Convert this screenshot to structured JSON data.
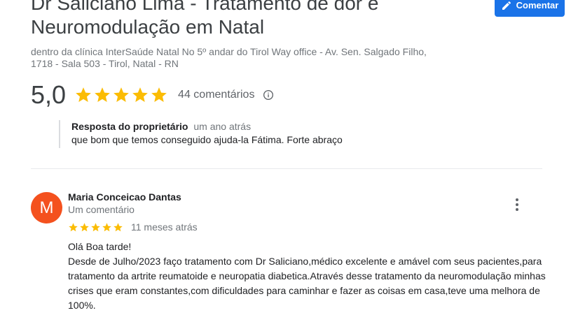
{
  "header": {
    "title": "Dr Saliciano Lima - Tratamento de dor e Neuromodulação em Natal",
    "comment_button": "Comentar",
    "comment_icon": "pencil-icon",
    "address": "dentro da clínica InterSaúde Natal No 5º andar do Tirol Way office - Av. Sen. Salgado Filho, 1718 - Sala 503 - Tirol, Natal - RN"
  },
  "rating": {
    "value": "5,0",
    "stars": 5,
    "count_label": "44 comentários",
    "info_icon": "info-icon",
    "star_color": "#fbbc04"
  },
  "owner_reply": {
    "label": "Resposta do proprietário",
    "time": "um ano atrás",
    "text": "que bom que temos conseguido ajuda-la Fátima. Forte abraço"
  },
  "review": {
    "avatar_letter": "M",
    "avatar_color": "#f4511e",
    "name": "Maria Conceicao Dantas",
    "meta": "Um comentário",
    "stars": 5,
    "time": "11 meses atrás",
    "more_icon": "more-vert-icon",
    "lines": [
      "Olá Boa tarde!",
      "Desde de Julho/2023 faço tratamento com Dr Saliciano,médico excelente e amável com seus pacientes,para tratamento da artrite reumatoide e neuropatia diabetica.Através desse tratamento da neuromodulação minhas crises que eram constantes,com dificuldades para caminhar e fazer as coisas em casa,teve uma melhora de 100%."
    ]
  }
}
